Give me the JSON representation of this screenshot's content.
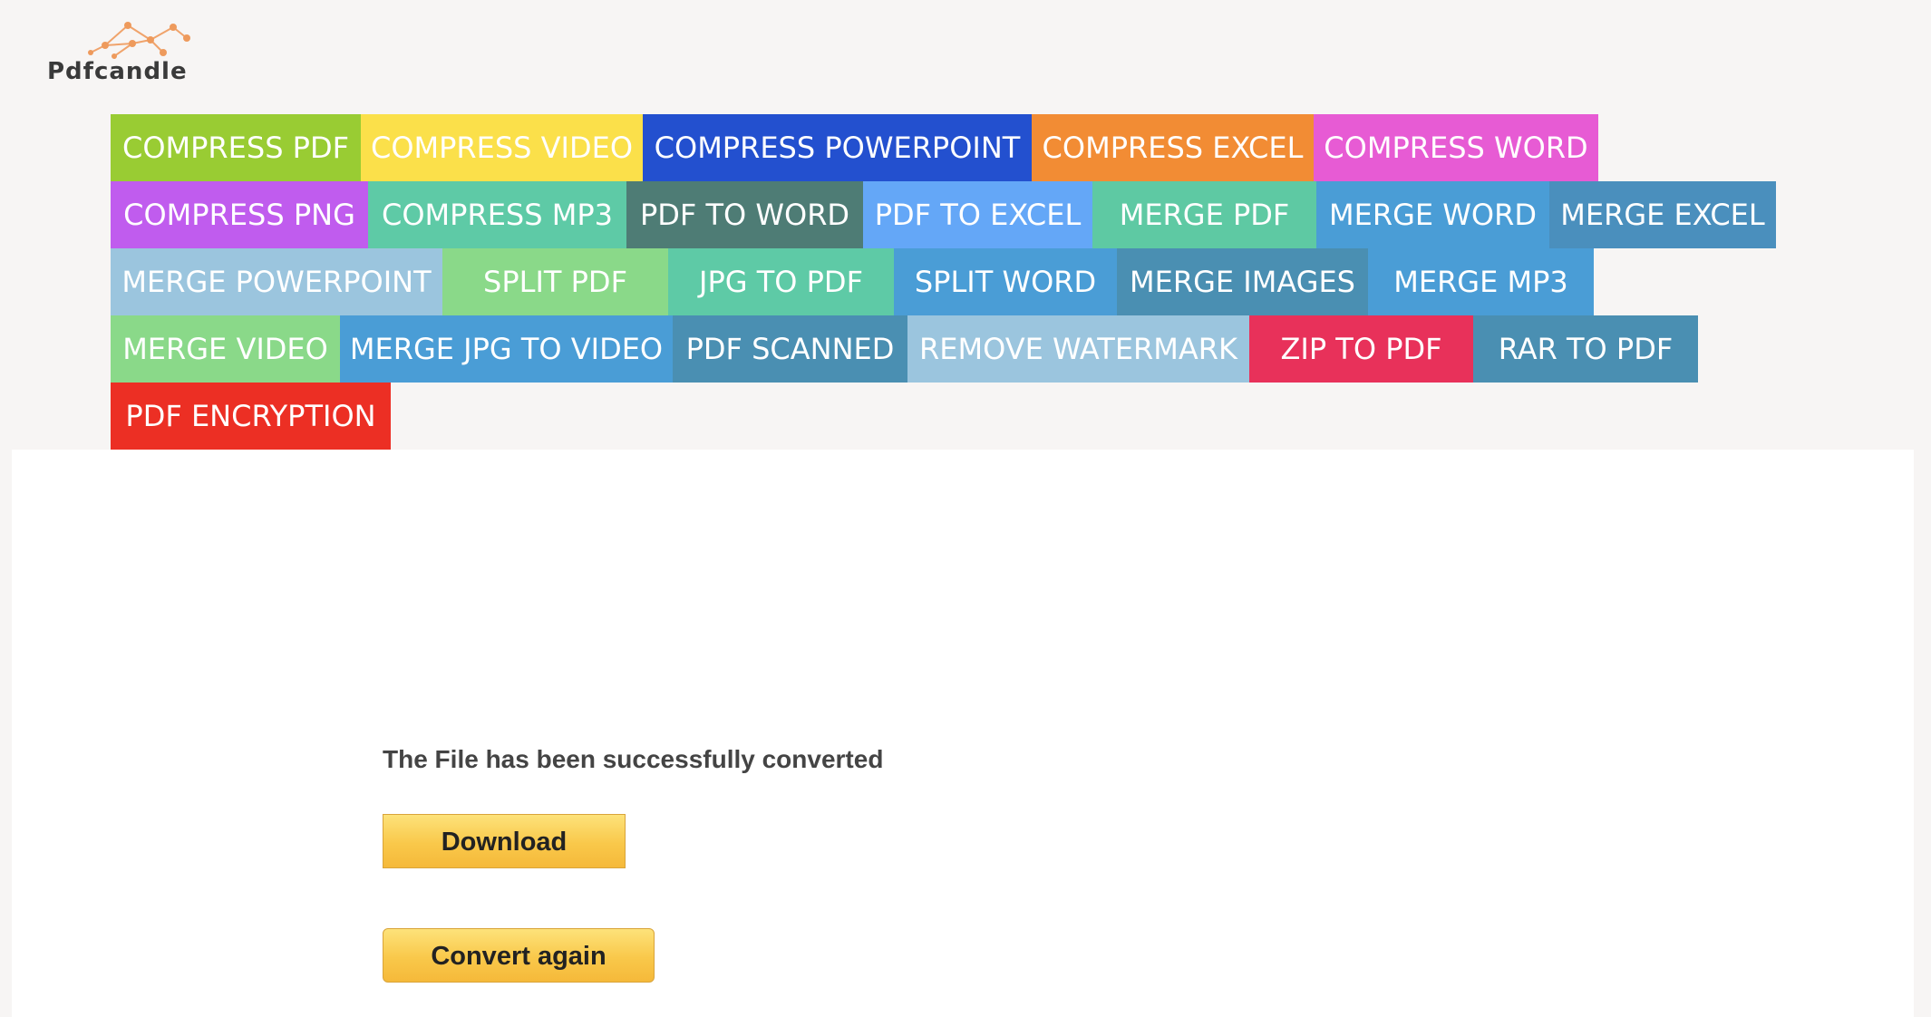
{
  "logo": {
    "text": "Pdfcandle",
    "mark_color": "#ee9a5c"
  },
  "nav": {
    "rows": [
      [
        {
          "label": "COMPRESS PDF",
          "color": "#99cc33"
        },
        {
          "label": "COMPRESS VIDEO",
          "color": "#fbe04a"
        },
        {
          "label": "COMPRESS POWERPOINT",
          "color": "#2350cf"
        },
        {
          "label": "COMPRESS EXCEL",
          "color": "#f28c34"
        },
        {
          "label": "COMPRESS WORD",
          "color": "#e75bd4"
        }
      ],
      [
        {
          "label": "COMPRESS PNG",
          "color": "#c05cee"
        },
        {
          "label": "COMPRESS MP3",
          "color": "#5ecaa6"
        },
        {
          "label": "PDF TO WORD",
          "color": "#4e7c75"
        },
        {
          "label": "PDF TO EXCEL",
          "color": "#64a7f7"
        },
        {
          "label": "MERGE PDF",
          "color": "#5ec9a3"
        },
        {
          "label": "MERGE WORD",
          "color": "#4a9dd6"
        },
        {
          "label": "MERGE EXCEL",
          "color": "#4a8fbd"
        }
      ],
      [
        {
          "label": "MERGE POWERPOINT",
          "color": "#9bc5de"
        },
        {
          "label": "SPLIT PDF",
          "color": "#8ad989"
        },
        {
          "label": "JPG TO PDF",
          "color": "#5ecaa6"
        },
        {
          "label": "SPLIT WORD",
          "color": "#4a9dd6"
        },
        {
          "label": "MERGE IMAGES",
          "color": "#4a8fb2"
        },
        {
          "label": "MERGE MP3",
          "color": "#4a9dd6"
        }
      ],
      [
        {
          "label": "MERGE VIDEO",
          "color": "#8ad989"
        },
        {
          "label": "MERGE JPG TO VIDEO",
          "color": "#4a9dd6"
        },
        {
          "label": "PDF SCANNED",
          "color": "#4a8fb2"
        },
        {
          "label": "REMOVE WATERMARK",
          "color": "#9bc5de"
        },
        {
          "label": "ZIP TO PDF",
          "color": "#e8315a"
        },
        {
          "label": "RAR TO PDF",
          "color": "#4a8fb2"
        }
      ],
      [
        {
          "label": "PDF ENCRYPTION",
          "color": "#ec2f24"
        }
      ]
    ]
  },
  "result": {
    "status": "The File has been successfully converted",
    "download_label": "Download",
    "convert_again_label": "Convert again"
  }
}
